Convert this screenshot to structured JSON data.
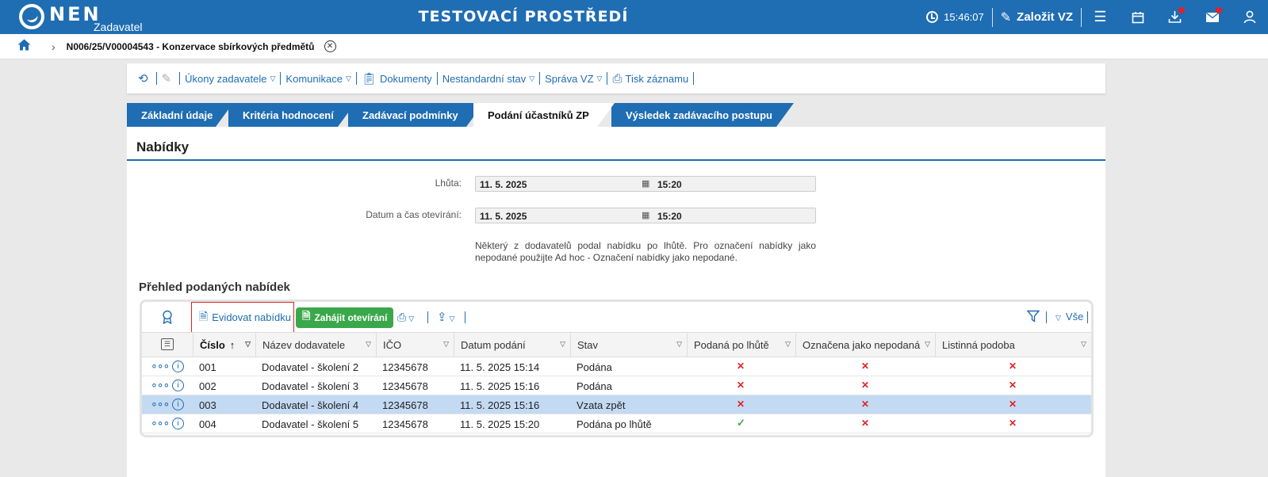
{
  "header": {
    "logo_text": "NEN",
    "logo_sub": "Zadavatel",
    "env_title": "TESTOVACÍ PROSTŘEDÍ",
    "time": "15:46:07",
    "new_vz_label": "Založit VZ"
  },
  "breadcrumb": {
    "text": "N006/25/V00004543 - Konzervace sbírkových předmětů"
  },
  "toolbar": {
    "items": [
      {
        "label": "Úkony zadavatele",
        "caret": true
      },
      {
        "label": "Komunikace",
        "caret": true
      },
      {
        "label": "Dokumenty",
        "caret": false
      },
      {
        "label": "Nestandardní stav",
        "caret": true
      },
      {
        "label": "Správa VZ",
        "caret": true
      },
      {
        "label": "Tisk záznamu",
        "caret": false
      }
    ]
  },
  "tabs": [
    {
      "label": "Základní údaje",
      "active": false
    },
    {
      "label": "Kritéria hodnocení",
      "active": false
    },
    {
      "label": "Zadávací podmínky",
      "active": false
    },
    {
      "label": "Podání účastníků ZP",
      "active": true
    },
    {
      "label": "Výsledek zadávacího postupu",
      "active": false
    }
  ],
  "card": {
    "title": "Nabídky",
    "lhuta_label": "Lhůta:",
    "lhuta_date": "11. 5. 2025",
    "lhuta_time": "15:20",
    "otevirani_label": "Datum a čas otevírání:",
    "otevirani_date": "11. 5. 2025",
    "otevirani_time": "15:20",
    "note": "Některý z dodavatelů podal nabídku po lhůtě. Pro označení nabídky jako nepodané použijte Ad hoc - Označení nabídky jako nepodané.",
    "section_title": "Přehled podaných nabídek"
  },
  "grid": {
    "evidovat_label": "Evidovat nabídku",
    "zahajit_label": "Zahájit otevírání",
    "all_label": "Vše",
    "columns": [
      "Číslo",
      "Název dodavatele",
      "IČO",
      "Datum podání",
      "Stav",
      "Podaná po lhůtě",
      "Označena jako nepodaná",
      "Listinná podoba"
    ],
    "rows": [
      {
        "cislo": "001",
        "nazev": "Dodavatel - školení 2",
        "ico": "12345678",
        "datum": "11. 5. 2025 15:14",
        "stav": "Podána",
        "po_lhute": false,
        "nepodana": false,
        "listinna": false,
        "selected": false
      },
      {
        "cislo": "002",
        "nazev": "Dodavatel - školení 3",
        "ico": "12345678",
        "datum": "11. 5. 2025 15:16",
        "stav": "Podána",
        "po_lhute": false,
        "nepodana": false,
        "listinna": false,
        "selected": false
      },
      {
        "cislo": "003",
        "nazev": "Dodavatel - školení 4",
        "ico": "12345678",
        "datum": "11. 5. 2025 15:16",
        "stav": "Vzata zpět",
        "po_lhute": false,
        "nepodana": false,
        "listinna": false,
        "selected": true
      },
      {
        "cislo": "004",
        "nazev": "Dodavatel - školení 5",
        "ico": "12345678",
        "datum": "11. 5. 2025 15:20",
        "stav": "Podána po lhůtě",
        "po_lhute": true,
        "nepodana": false,
        "listinna": false,
        "selected": false
      }
    ]
  },
  "colors": {
    "brand": "#1f6db3",
    "green": "#3aa84a",
    "red": "#e0222a",
    "selected_row": "#c4daf3"
  }
}
